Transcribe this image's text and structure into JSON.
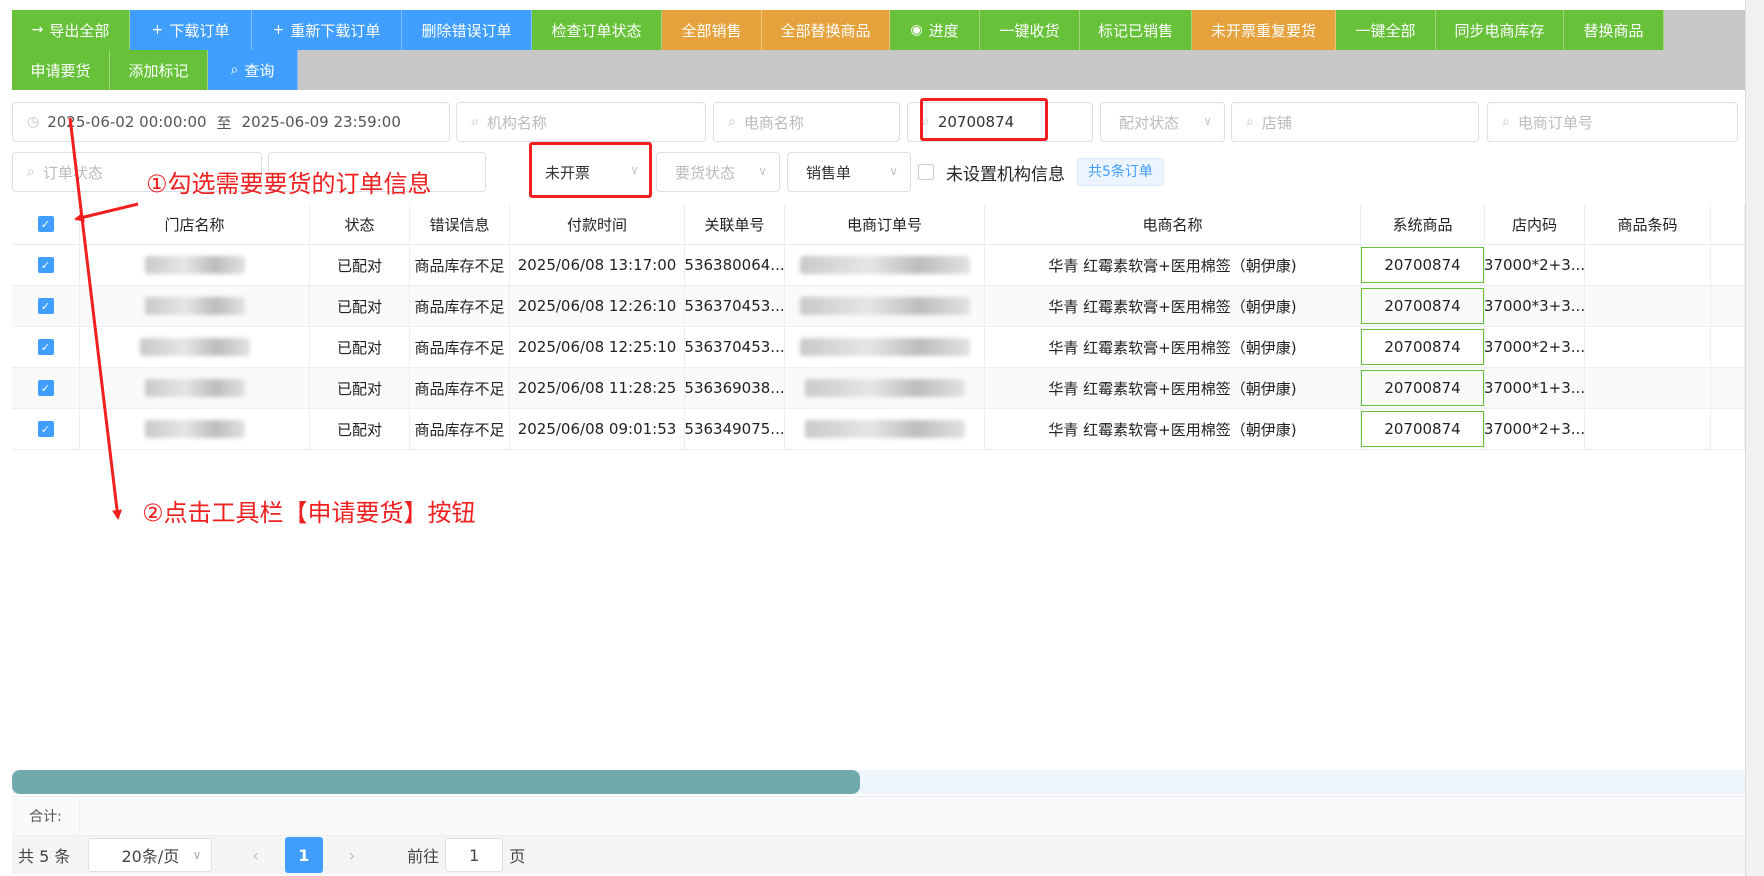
{
  "toolbar": {
    "row1": [
      {
        "icon": "arrow-right-icon",
        "glyph": "→",
        "label": "导出全部",
        "color": "green"
      },
      {
        "icon": "plus-icon",
        "glyph": "+",
        "label": "下载订单",
        "color": "blue"
      },
      {
        "icon": "plus-icon",
        "glyph": "+",
        "label": "重新下载订单",
        "color": "blue"
      },
      {
        "icon": "",
        "glyph": "",
        "label": "删除错误订单",
        "color": "blue"
      },
      {
        "icon": "",
        "glyph": "",
        "label": "检查订单状态",
        "color": "green"
      },
      {
        "icon": "",
        "glyph": "",
        "label": "全部销售",
        "color": "orange"
      },
      {
        "icon": "",
        "glyph": "",
        "label": "全部替换商品",
        "color": "orange"
      },
      {
        "icon": "eye-icon",
        "glyph": "◉",
        "label": "进度",
        "color": "green"
      },
      {
        "icon": "",
        "glyph": "",
        "label": "一键收货",
        "color": "green"
      },
      {
        "icon": "",
        "glyph": "",
        "label": "标记已销售",
        "color": "green"
      },
      {
        "icon": "",
        "glyph": "",
        "label": "未开票重复要货",
        "color": "orange"
      },
      {
        "icon": "",
        "glyph": "",
        "label": "一键全部",
        "color": "green"
      },
      {
        "icon": "",
        "glyph": "",
        "label": "同步电商库存",
        "color": "green"
      },
      {
        "icon": "",
        "glyph": "",
        "label": "替换商品",
        "color": "green"
      }
    ],
    "row2": [
      {
        "icon": "",
        "glyph": "",
        "label": "申请要货",
        "color": "green"
      },
      {
        "icon": "",
        "glyph": "",
        "label": "添加标记",
        "color": "green"
      },
      {
        "icon": "search-icon",
        "glyph": "⌕",
        "label": "查询",
        "color": "blue"
      }
    ]
  },
  "filters": {
    "date_start": "2025-06-02 00:00:00",
    "date_sep": "至",
    "date_end": "2025-06-09 23:59:00",
    "org_name_placeholder": "机构名称",
    "ecom_name_placeholder": "电商名称",
    "product_code_value": "20700874",
    "match_status_placeholder": "配对状态",
    "shop_placeholder": "店铺",
    "ecom_order_placeholder": "电商订单号",
    "order_status_placeholder": "订单状态",
    "invoice_status_value": "未开票",
    "request_status_placeholder": "要货状态",
    "order_type_value": "销售单",
    "no_org_info_label": "未设置机构信息",
    "total_tag": "共5条订单"
  },
  "table": {
    "headers": [
      "门店名称",
      "状态",
      "错误信息",
      "付款时间",
      "关联单号",
      "电商订单号",
      "电商名称",
      "系统商品",
      "店内码",
      "商品条码"
    ],
    "rows": [
      {
        "status": "已配对",
        "error": "商品库存不足",
        "pay_time": "2025/06/08 13:17:00",
        "related_no": "536380064...",
        "ecom_name": "华青 红霉素软膏+医用棉签（朝伊康)",
        "sys_product": "20700874",
        "store_code": "37000*2+3..."
      },
      {
        "status": "已配对",
        "error": "商品库存不足",
        "pay_time": "2025/06/08 12:26:10",
        "related_no": "536370453...",
        "ecom_name": "华青 红霉素软膏+医用棉签（朝伊康)",
        "sys_product": "20700874",
        "store_code": "37000*3+3..."
      },
      {
        "status": "已配对",
        "error": "商品库存不足",
        "pay_time": "2025/06/08 12:25:10",
        "related_no": "536370453...",
        "ecom_name": "华青 红霉素软膏+医用棉签（朝伊康)",
        "sys_product": "20700874",
        "store_code": "37000*2+3..."
      },
      {
        "status": "已配对",
        "error": "商品库存不足",
        "pay_time": "2025/06/08 11:28:25",
        "related_no": "536369038...",
        "ecom_name": "华青 红霉素软膏+医用棉签（朝伊康)",
        "sys_product": "20700874",
        "store_code": "37000*1+3..."
      },
      {
        "status": "已配对",
        "error": "商品库存不足",
        "pay_time": "2025/06/08 09:01:53",
        "related_no": "536349075...",
        "ecom_name": "华青 红霉素软膏+医用棉签（朝伊康)",
        "sys_product": "20700874",
        "store_code": "37000*2+3..."
      }
    ]
  },
  "annotations": {
    "step1": "①勾选需要要货的订单信息",
    "step2": "②点击工具栏【申请要货】按钮",
    "color": "#f02020"
  },
  "summary": {
    "label": "合计:"
  },
  "pager": {
    "total": "共 5 条",
    "page_size": "20条/页",
    "current_page": "1",
    "goto_label": "前往",
    "goto_value": "1",
    "page_unit": "页"
  },
  "colors": {
    "green": "#67c23a",
    "blue": "#409eff",
    "orange": "#e6a23c"
  }
}
